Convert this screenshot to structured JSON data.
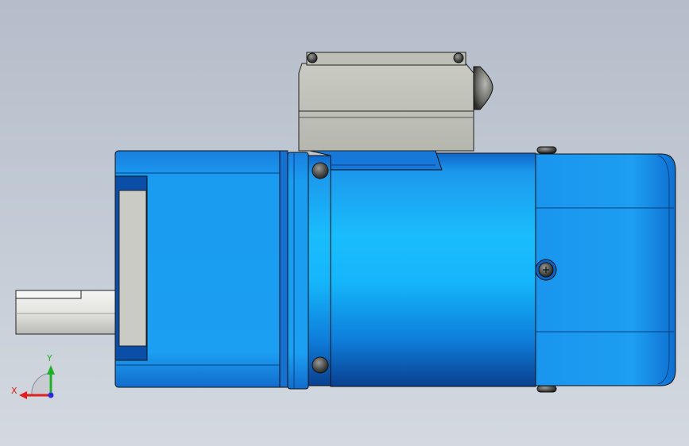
{
  "viewport": {
    "background_top": "#b4bdc9",
    "background_bottom": "#d4d9e0"
  },
  "model": {
    "parts": [
      "output-shaft",
      "gearbox",
      "mounting-flange",
      "motor-body",
      "terminal-box",
      "end-cap"
    ],
    "body_color": "#1aa6f0",
    "body_color_dark": "#0a3f8f",
    "terminal_box_color": "#c4c6bd"
  },
  "triad": {
    "x_label": "X",
    "y_label": "Y",
    "x_color": "#e0201c",
    "y_color": "#1fb02a",
    "z_color": "#2a2ae0"
  }
}
